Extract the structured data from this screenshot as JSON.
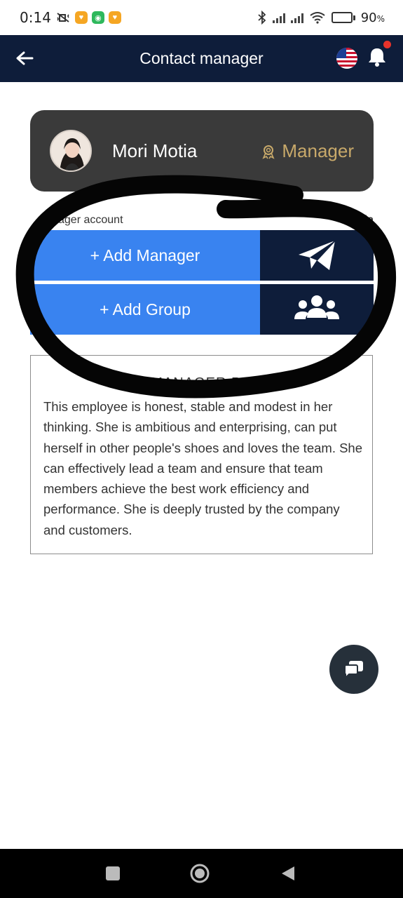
{
  "status_bar": {
    "time": "0:14",
    "battery": "90",
    "battery_unit": "%",
    "battery_level": 0.9,
    "icons": [
      "vibrate-off-icon",
      "app-badge-icon",
      "app-badge-icon",
      "app-badge-icon",
      "bluetooth-icon",
      "signal-icon",
      "signal-icon",
      "wifi-icon",
      "battery-icon"
    ],
    "colors": {
      "badge_orange": "#f5a623",
      "badge_green": "#2eb85c"
    }
  },
  "header": {
    "title": "Contact manager",
    "back_icon": "arrow-left-icon",
    "flag_icon": "us-flag-icon",
    "bell_icon": "bell-icon",
    "background": "#0e1d3a"
  },
  "manager_card": {
    "name": "Mori Motia",
    "role": "Manager",
    "role_icon": "award-icon",
    "role_color": "#c8a96a"
  },
  "account_row": {
    "label": "ager account",
    "name": "Motia"
  },
  "actions": [
    {
      "label": "+ Add Manager",
      "icon": "paper-plane-icon"
    },
    {
      "label": "+ Add Group",
      "icon": "group-icon"
    }
  ],
  "action_colors": {
    "main": "#3983f0",
    "icon_bg": "#0e1d3a"
  },
  "profile": {
    "title": "MANAGER PR",
    "text": "This employee is honest, stable and modest in her thinking. She is ambitious and enterprising, can put herself in other people's shoes and loves the team. She can effectively lead a team and ensure that team members achieve the best work efficiency and performance. She is deeply trusted by the company and customers."
  },
  "chat_fab": {
    "icon": "chat-icon"
  },
  "nav": {
    "icons": [
      "square-icon",
      "circle-icon",
      "triangle-back-icon"
    ]
  }
}
